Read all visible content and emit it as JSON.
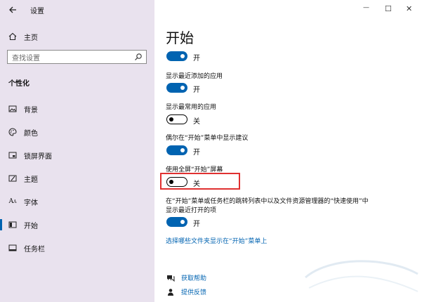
{
  "window": {
    "title": "设置",
    "back_icon": "back-arrow-icon",
    "controls": {
      "minimize": "—",
      "maximize": "☐",
      "close": "✕"
    }
  },
  "sidebar": {
    "home": "主页",
    "search_placeholder": "查找设置",
    "section_title": "个性化",
    "items": [
      {
        "label": "背景",
        "icon": "picture-icon"
      },
      {
        "label": "颜色",
        "icon": "palette-icon"
      },
      {
        "label": "锁屏界面",
        "icon": "lock-screen-icon"
      },
      {
        "label": "主题",
        "icon": "theme-icon"
      },
      {
        "label": "字体",
        "icon": "font-icon"
      },
      {
        "label": "开始",
        "icon": "start-icon",
        "active": true
      },
      {
        "label": "任务栏",
        "icon": "taskbar-icon"
      }
    ]
  },
  "main": {
    "title": "开始",
    "settings": [
      {
        "label": "",
        "state": "开",
        "on": true
      },
      {
        "label": "显示最近添加的应用",
        "state": "开",
        "on": true
      },
      {
        "label": "显示最常用的应用",
        "state": "关",
        "on": false
      },
      {
        "label": "偶尔在“开始”菜单中显示建议",
        "state": "开",
        "on": true
      },
      {
        "label": "使用全屏“开始”屏幕",
        "state": "关",
        "on": false
      },
      {
        "label_line1": "在“开始”菜单或任务栏的跳转列表中以及文件资源管理器的“快速使用”中",
        "label_line2": "显示最近打开的项",
        "state": "开",
        "on": true
      }
    ],
    "folders_link": "选择哪些文件夹显示在“开始”菜单上",
    "help": "获取帮助",
    "feedback": "提供反馈"
  },
  "colors": {
    "accent": "#0063b1",
    "sidebar_bg": "#e9e2ee",
    "highlight": "#e03030"
  }
}
